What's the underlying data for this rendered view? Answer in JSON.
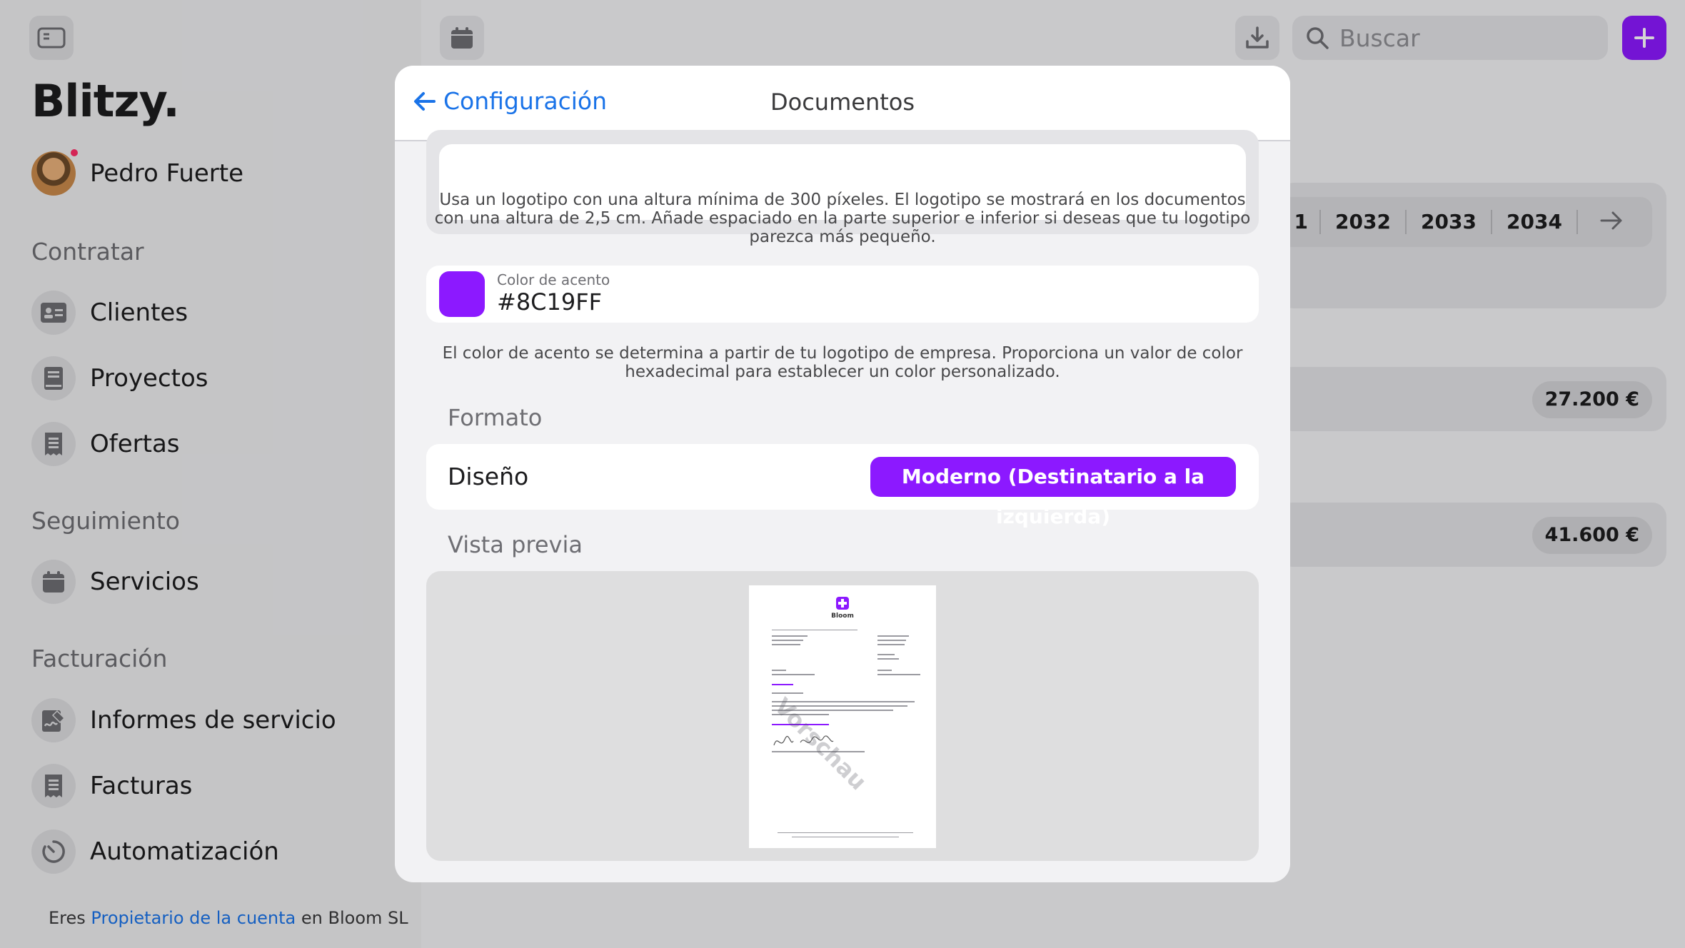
{
  "sidebar": {
    "brand": "Blitzy.",
    "user_name": "Pedro Fuerte",
    "sections": {
      "contratar": "Contratar",
      "seguimiento": "Seguimiento",
      "facturacion": "Facturación"
    },
    "items": {
      "clientes": "Clientes",
      "proyectos": "Proyectos",
      "ofertas": "Ofertas",
      "servicios": "Servicios",
      "informes": "Informes de servicio",
      "facturas": "Facturas",
      "automatizacion": "Automatización"
    },
    "footer": {
      "prefix": "Eres",
      "link": "Propietario de la cuenta",
      "suffix": "en Bloom SL"
    }
  },
  "topbar": {
    "search_placeholder": "Buscar"
  },
  "background": {
    "years": [
      "1",
      "2032",
      "2033",
      "2034"
    ],
    "amounts": [
      "27.200 €",
      "41.600 €"
    ]
  },
  "modal": {
    "back_label": "Configuración",
    "title": "Documentos",
    "logo_hint": "Usa un logotipo con una altura mínima de 300 píxeles. El logotipo se mostrará en los documentos con una altura de 2,5 cm. Añade espaciado en la parte superior e inferior si deseas que tu logotipo parezca más pequeño.",
    "accent_label": "Color de acento",
    "accent_value": "#8C19FF",
    "accent_hint": "El color de acento se determina a partir de tu logotipo de empresa. Proporciona un valor de color hexadecimal para establecer un color personalizado.",
    "format_title": "Formato",
    "design_label": "Diseño",
    "design_value": "Moderno (Destinatario a la izquierda)",
    "preview_title": "Vista previa",
    "preview_watermark": "Vorschau",
    "preview_brand": "Bloom"
  },
  "colors": {
    "accent": "#8C19FF",
    "link": "#1A73E8",
    "notification_dot": "#FF2D68"
  }
}
